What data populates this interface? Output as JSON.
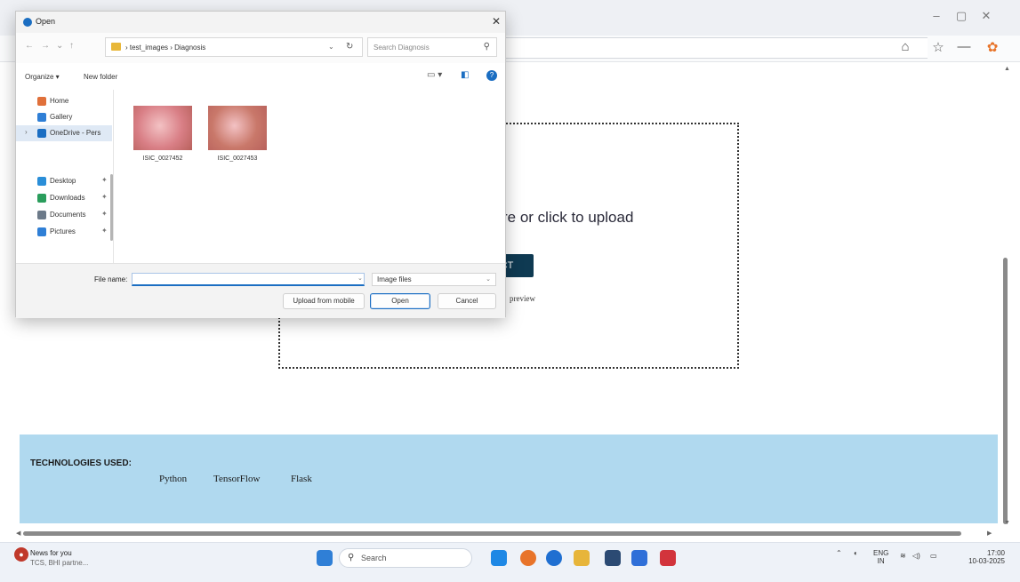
{
  "dialog": {
    "title": "Open",
    "close_glyph": "✕",
    "breadcrumb": "› test_images › Diagnosis",
    "search_placeholder": "Search Diagnosis",
    "organize_label": "Organize ▾",
    "new_folder_label": "New folder",
    "nav_items": [
      {
        "label": "Home",
        "icon": "home-icon",
        "color": "#e0703a"
      },
      {
        "label": "Gallery",
        "icon": "gallery-icon",
        "color": "#2f7fd6"
      },
      {
        "label": "OneDrive - Pers",
        "icon": "onedrive-icon",
        "color": "#1b6ec2"
      },
      {
        "label": "Desktop",
        "icon": "desktop-icon",
        "color": "#2a8ed8"
      },
      {
        "label": "Downloads",
        "icon": "downloads-icon",
        "color": "#2a9d5c"
      },
      {
        "label": "Documents",
        "icon": "documents-icon",
        "color": "#6c7a89"
      },
      {
        "label": "Pictures",
        "icon": "pictures-icon",
        "color": "#2f7fd6"
      }
    ],
    "files": [
      {
        "name": "ISIC_0027452",
        "thumb_color": "#d97f86"
      },
      {
        "name": "ISIC_0027453",
        "thumb_color": "#c9786a"
      }
    ],
    "file_name_label": "File name:",
    "file_name_value": "",
    "file_type_label": "Image files",
    "upload_mobile_label": "Upload from mobile",
    "open_label": "Open",
    "cancel_label": "Cancel"
  },
  "page": {
    "upload_text": "re or click to upload",
    "upload_button_label": "CT",
    "preview_text": "preview",
    "tech_title": "TECHNOLOGIES USED:",
    "tech_items": [
      "Python",
      "TensorFlow",
      "Flask"
    ]
  },
  "taskbar": {
    "news_title": "News for you",
    "news_sub": "TCS, BHI partne...",
    "search_placeholder": "Search",
    "lang_top": "ENG",
    "lang_bottom": "IN",
    "time": "17:00",
    "date": "10-03-2025",
    "app_colors": [
      "#2b2b2b",
      "#1e88e5",
      "#e8742a",
      "#1f6fd1",
      "#e7b53a",
      "#2b4a73",
      "#2f6fd8",
      "#d2343c"
    ]
  }
}
